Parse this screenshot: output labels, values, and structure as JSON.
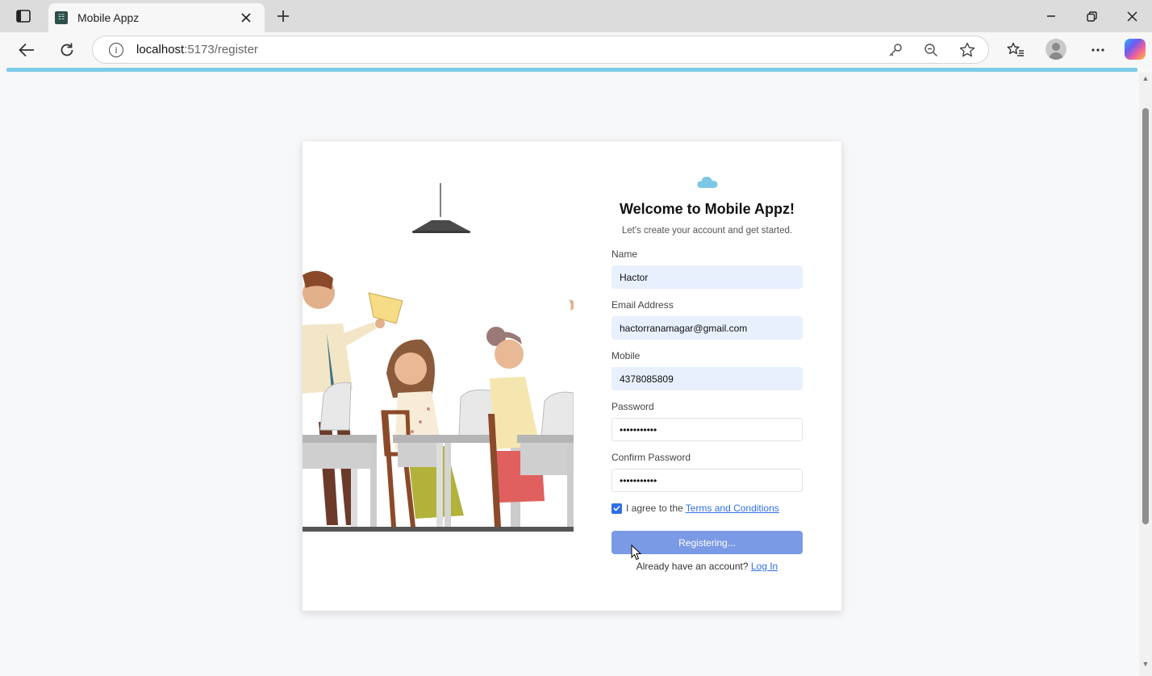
{
  "browser": {
    "tab_title": "Mobile Appz",
    "url_host": "localhost",
    "url_path": ":5173/register",
    "icons": [
      "sidebar-icon",
      "close-icon",
      "plus-icon",
      "minimize-icon",
      "restore-icon",
      "back-icon",
      "reload-icon",
      "info-icon",
      "key-icon",
      "zoom-out-icon",
      "star-icon",
      "favorites-icon",
      "profile-icon",
      "more-icon",
      "copilot-icon"
    ]
  },
  "register": {
    "title": "Welcome to Mobile Appz!",
    "subtitle": "Let's create your account and get started.",
    "name_label": "Name",
    "name_value": "Hactor",
    "email_label": "Email Address",
    "email_value": "hactorranamagar@gmail.com",
    "mobile_label": "Mobile",
    "mobile_value": "4378085809",
    "password_label": "Password",
    "password_value": "•••••••••••",
    "confirm_label": "Confirm Password",
    "confirm_value": "•••••••••••",
    "agree_text": "I agree to the",
    "terms_link": "Terms and Conditions",
    "submit_label": "Registering...",
    "login_prompt": "Already have an account?",
    "login_link": "Log In",
    "agreed": true
  },
  "colors": {
    "accent": "#2f6fea",
    "button_disabled": "#7b9ae6",
    "autofill": "#e8f0fe",
    "loadbar": "#7ecbea",
    "cloud": "#7cc7e8"
  }
}
